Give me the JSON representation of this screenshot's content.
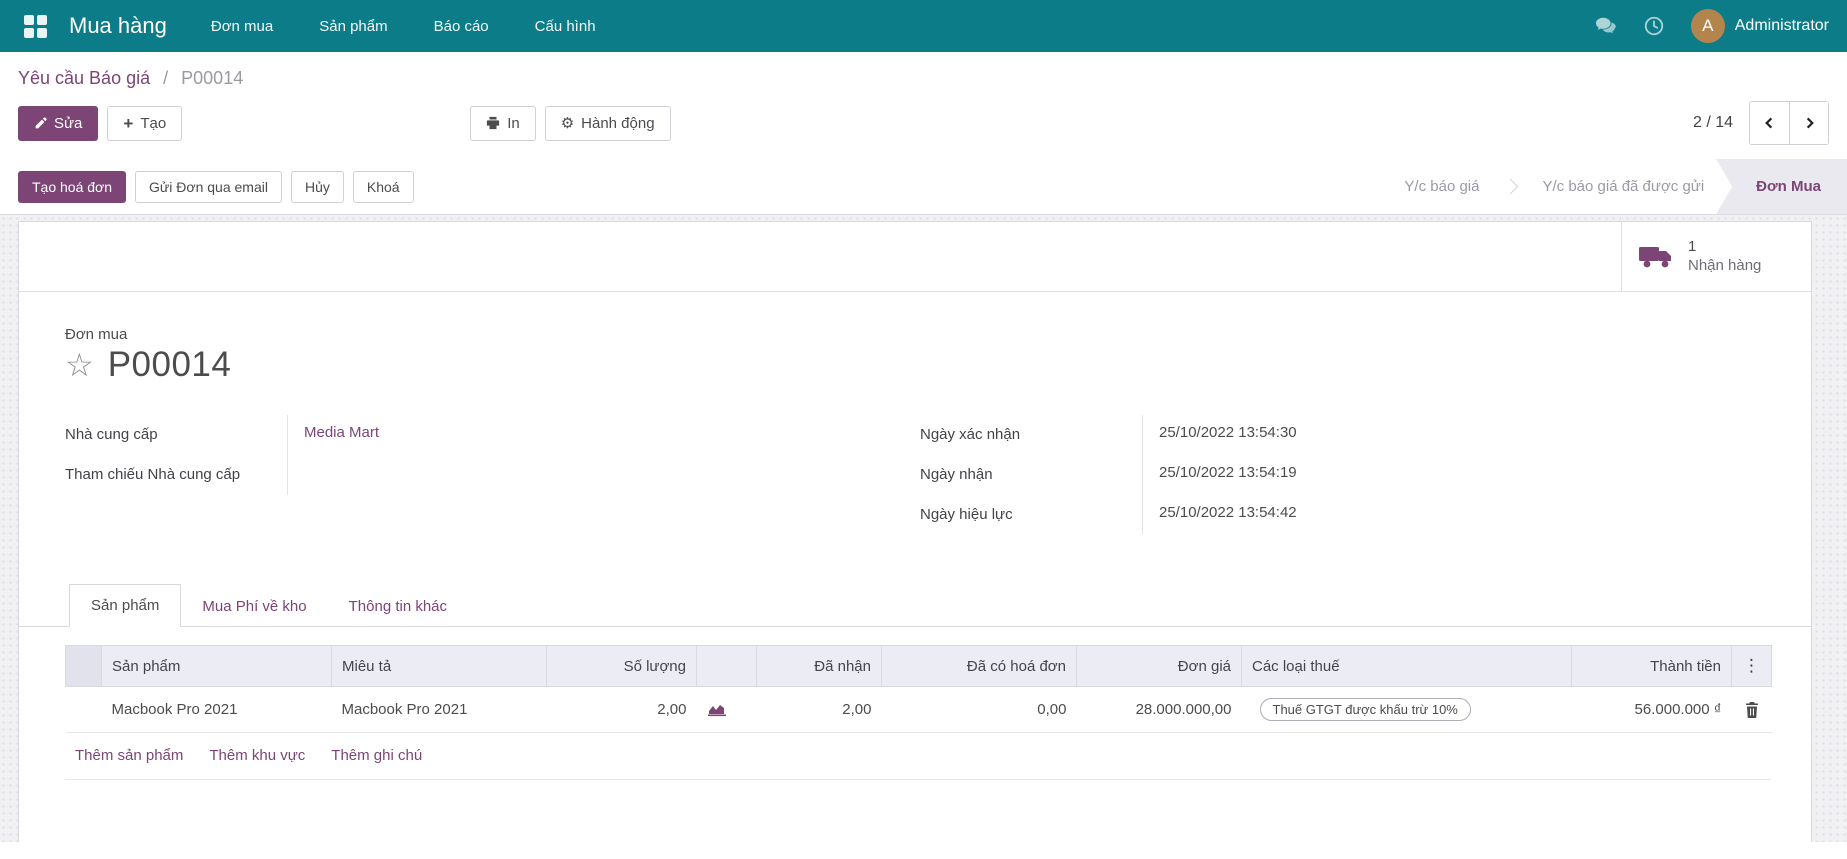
{
  "colors": {
    "primary": "#7C4576",
    "navbar_teal": "#0C7D88",
    "avatar_bg": "#B3854D",
    "step_active_bg": "#E9E9EF"
  },
  "icons": {
    "gear": "⚙",
    "plus": "+",
    "star": "☆",
    "kebab": "⋮",
    "breadcrumb_sep": "/"
  },
  "navbar": {
    "brand": "Mua hàng",
    "menus": [
      "Đơn mua",
      "Sản phẩm",
      "Báo cáo",
      "Cấu hình"
    ],
    "avatar_letter": "A",
    "user": "Administrator"
  },
  "breadcrumb": {
    "parent": "Yêu cầu Báo giá",
    "current": "P00014"
  },
  "control_panel": {
    "edit": "Sửa",
    "create": "Tạo",
    "print": "In",
    "action": "Hành động",
    "pager": "2 / 14"
  },
  "statusbar": {
    "buttons": [
      {
        "label": "Tạo hoá đơn"
      },
      {
        "label": "Gửi Đơn qua email"
      },
      {
        "label": "Hủy"
      },
      {
        "label": "Khoá"
      }
    ],
    "steps": [
      {
        "label": "Y/c báo giá"
      },
      {
        "label": "Y/c báo giá đã được gửi"
      },
      {
        "label": "Đơn Mua"
      }
    ]
  },
  "smart_button": {
    "count": "1",
    "label": "Nhận hàng"
  },
  "form": {
    "doc_type": "Đơn mua",
    "doc_name": "P00014",
    "left_fields": [
      {
        "label": "Nhà cung cấp",
        "value": "Media Mart"
      },
      {
        "label": "Tham chiếu Nhà cung cấp",
        "value": ""
      }
    ],
    "right_fields": [
      {
        "label": "Ngày xác nhận",
        "value": "25/10/2022 13:54:30"
      },
      {
        "label": "Ngày nhận",
        "value": "25/10/2022 13:54:19"
      },
      {
        "label": "Ngày hiệu lực",
        "value": "25/10/2022 13:54:42"
      }
    ]
  },
  "tabs": [
    {
      "label": "Sản phẩm"
    },
    {
      "label": "Mua Phí về kho"
    },
    {
      "label": "Thông tin khác"
    }
  ],
  "table": {
    "headers": [
      "Sản phẩm",
      "Miêu tả",
      "Số lượng",
      "",
      "Đã nhận",
      "Đã có hoá đơn",
      "Đơn giá",
      "Các loại thuế",
      "Thành tiền"
    ],
    "rows": [
      {
        "product": "Macbook Pro 2021",
        "description": "Macbook Pro 2021",
        "qty": "2,00",
        "received": "2,00",
        "billed": "0,00",
        "unit_price": "28.000.000,00",
        "taxes": "Thuế GTGT được khấu trừ 10%",
        "subtotal": "56.000.000 ₫"
      }
    ],
    "footer_links": [
      "Thêm sản phẩm",
      "Thêm khu vực",
      "Thêm ghi chú"
    ]
  }
}
